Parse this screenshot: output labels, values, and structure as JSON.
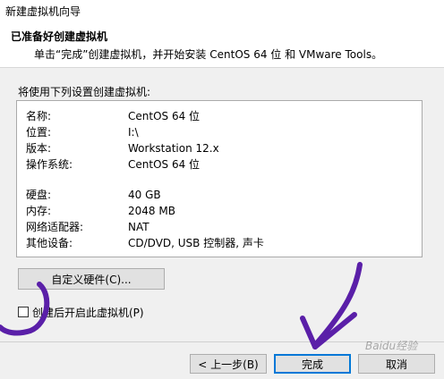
{
  "window": {
    "title": "新建虚拟机向导"
  },
  "header": {
    "title": "已准备好创建虚拟机",
    "subtitle": "单击“完成”创建虚拟机，并开始安装 CentOS 64 位 和 VMware Tools。"
  },
  "summary": {
    "label": "将使用下列设置创建虚拟机:",
    "rows": [
      {
        "key": "名称:",
        "value": "CentOS 64 位"
      },
      {
        "key": "位置:",
        "value": "I:\\"
      },
      {
        "key": "版本:",
        "value": "Workstation 12.x"
      },
      {
        "key": "操作系统:",
        "value": "CentOS 64 位"
      },
      {
        "key": "硬盘:",
        "value": "40 GB"
      },
      {
        "key": "内存:",
        "value": "2048 MB"
      },
      {
        "key": "网络适配器:",
        "value": "NAT"
      },
      {
        "key": "其他设备:",
        "value": "CD/DVD, USB 控制器, 声卡"
      }
    ]
  },
  "buttons": {
    "customize": "自定义硬件(C)...",
    "back": "< 上一步(B)",
    "finish": "完成",
    "cancel": "取消"
  },
  "options": {
    "power_on_label": "创建后开启此虚拟机(P)",
    "power_on_checked": false
  },
  "annotation": {
    "color": "#5a1fa8"
  },
  "watermark": {
    "text": "Baidu经验"
  }
}
